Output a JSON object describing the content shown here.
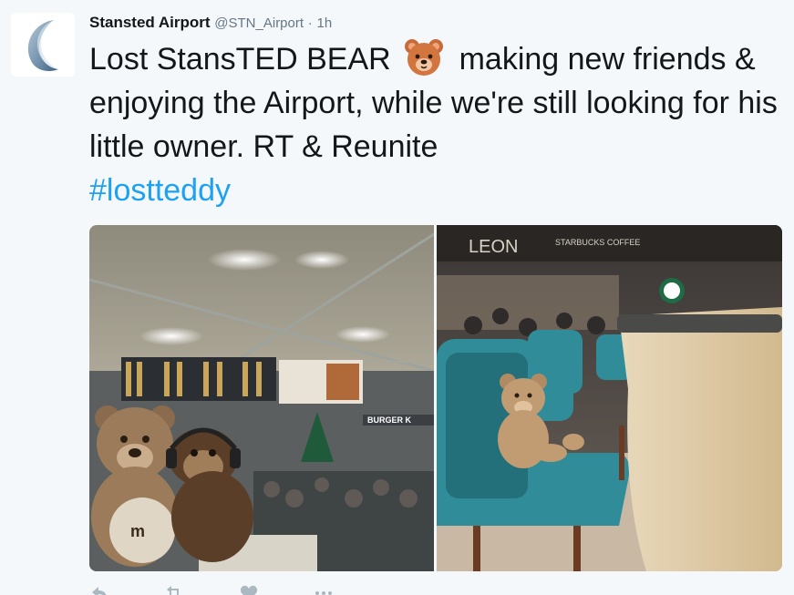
{
  "tweet": {
    "display_name": "Stansted Airport",
    "handle": "@STN_Airport",
    "separator": "·",
    "time": "1h",
    "text_part1": "Lost StansTED BEAR",
    "emoji": "bear-face-emoji",
    "text_part2": "making new friends & enjoying the Airport, while we're still looking for his little owner. RT & Reunite",
    "hashtag": "#lostteddy"
  },
  "media": {
    "left_photo": {
      "description_icon": "teddy-bears-terminal-photo",
      "sign_text": "BURGER K"
    },
    "right_photo": {
      "description_icon": "teddy-bear-bar-stool-photo",
      "sign_leon": "LEON",
      "sign_starbucks": "STARBUCKS COFFEE"
    }
  },
  "actions": [
    {
      "name": "reply-icon"
    },
    {
      "name": "retweet-icon"
    },
    {
      "name": "like-icon"
    },
    {
      "name": "more-icon"
    }
  ],
  "colors": {
    "background": "#f5f8fa",
    "hashtag": "#1da1f2",
    "text": "#14171a",
    "muted": "#657786",
    "avatar_logo": "#5a7a96"
  }
}
